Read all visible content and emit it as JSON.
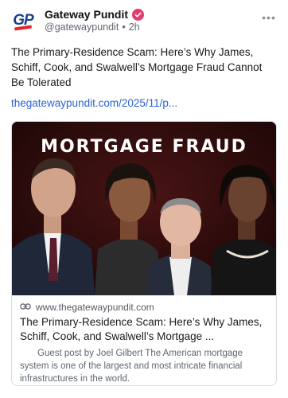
{
  "author": {
    "avatar_text": "GP",
    "display_name": "Gateway Pundit",
    "handle": "@gatewaypundit",
    "separator": "•",
    "time": "2h",
    "verified_color": "#e23b6e"
  },
  "post": {
    "text": "The Primary-Residence Scam: Here’s Why James, Schiff, Cook, and Swalwell’s Mortgage Fraud Cannot Be Tolerated",
    "link_text": "thegatewaypundit.com/2025/11/p..."
  },
  "card": {
    "image_headline": "MORTGAGE FRAUD",
    "domain": "www.thegatewaypundit.com",
    "title": "The Primary-Residence Scam: Here’s Why James, Schiff, Cook, and Swalwell’s Mortgage ...",
    "description": "Guest post by Joel Gilbert The American mortgage system is one of the largest and most intricate financial infrastructures in the world."
  },
  "colors": {
    "link": "#2a63d6",
    "image_background": "#2a0e0e"
  },
  "icons": {
    "more": "more-options-icon",
    "link": "link-icon",
    "verified": "verified-badge-icon"
  }
}
